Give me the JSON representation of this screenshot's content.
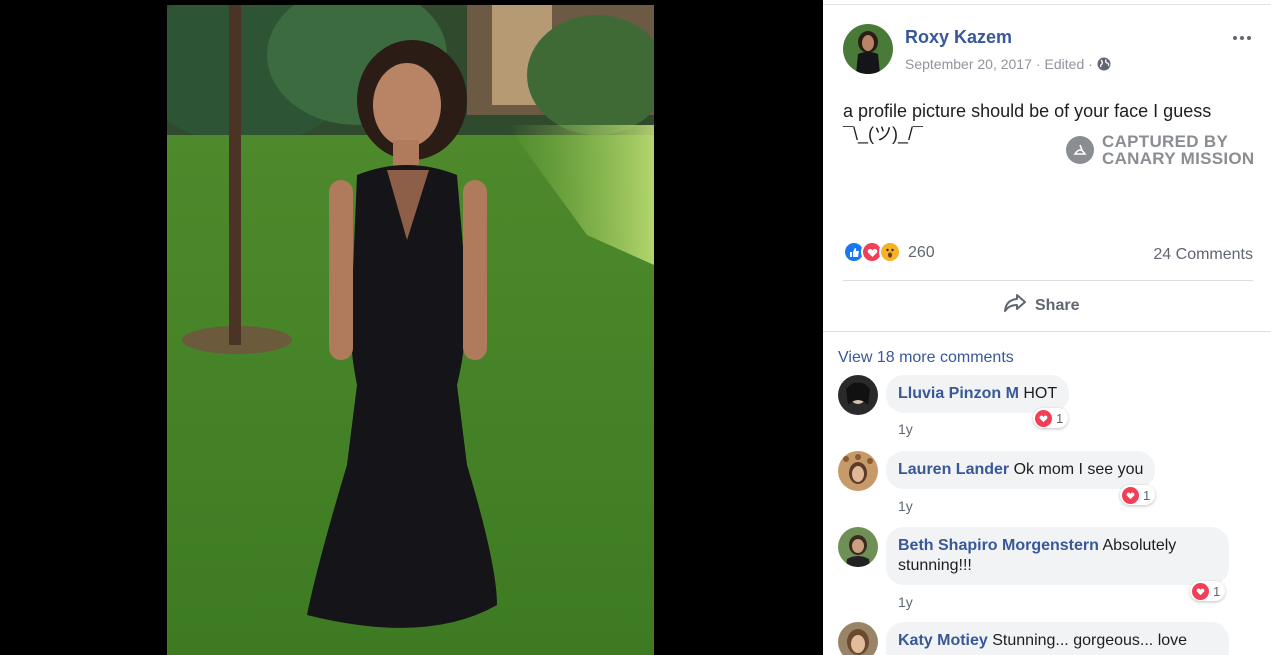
{
  "post": {
    "author": "Roxy Kazem",
    "date": "September 20, 2017",
    "edited": "Edited",
    "privacy_icon": "globe-icon",
    "text": "a profile picture should be of your face I guess ¯\\_(ツ)_/¯",
    "more_icon": "more-dots-icon"
  },
  "watermark": {
    "line1": "CAPTURED BY",
    "line2": "CANARY MISSION"
  },
  "reactions": {
    "icons": [
      "like-icon",
      "love-icon",
      "wow-icon"
    ],
    "count": "260",
    "comments": "24 Comments"
  },
  "actions": {
    "share": "Share"
  },
  "comments_section": {
    "view_more": "View 18 more comments",
    "items": [
      {
        "name": "Lluvia Pinzon M",
        "text": "HOT",
        "reaction_count": "1",
        "time": "1y"
      },
      {
        "name": "Lauren Lander",
        "text": "Ok mom I see you",
        "reaction_count": "1",
        "time": "1y"
      },
      {
        "name": "Beth Shapiro Morgenstern",
        "text": "Absolutely stunning!!!",
        "reaction_count": "1",
        "time": "1y"
      },
      {
        "name": "Katy Motiey",
        "text": "Stunning... gorgeous... love",
        "reaction_count": "",
        "time": ""
      }
    ]
  },
  "colors": {
    "link": "#385898",
    "love": "#f33e58",
    "like": "#1877f2",
    "wow": "#f7b125"
  }
}
